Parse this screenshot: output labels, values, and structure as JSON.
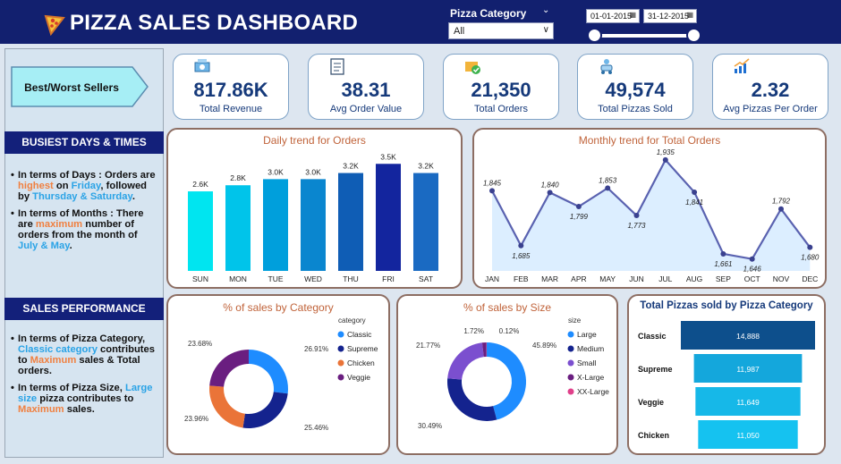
{
  "header": {
    "title": "PIZZA SALES DASHBOARD"
  },
  "filters": {
    "category_label": "Pizza Category",
    "category_value": "All",
    "date_start": "01-01-2015",
    "date_end": "31-12-2015"
  },
  "sidebar": {
    "best_worst": "Best/Worst Sellers",
    "busiest": {
      "heading": "BUSIEST DAYS & TIMES",
      "b1": {
        "t1": "In terms of Days :  Orders are ",
        "t2": "highest",
        "t3": " on ",
        "t4": "Friday",
        "t5": ", followed by ",
        "t6": "Thursday & Saturday",
        "t7": "."
      },
      "b2": {
        "t1": "In terms of Months : There are ",
        "t2": "maximum",
        "t3": " number of orders from the month of ",
        "t4": "July & May",
        "t5": "."
      }
    },
    "sales": {
      "heading": "SALES PERFORMANCE",
      "b1": {
        "t1": "In terms of Pizza Category, ",
        "t2": "Classic category",
        "t3": " contributes to ",
        "t4": "Maximum",
        "t5": " sales & Total orders."
      },
      "b2": {
        "t1": "In terms of Pizza Size, ",
        "t2": "Large size",
        "t3": " pizza contributes to ",
        "t4": "Maximum",
        "t5": " sales."
      }
    }
  },
  "kpis": [
    {
      "value": "817.86K",
      "label": "Total Revenue",
      "icon": "money-icon"
    },
    {
      "value": "38.31",
      "label": "Avg Order Value",
      "icon": "clipboard-icon"
    },
    {
      "value": "21,350",
      "label": "Total Orders",
      "icon": "cart-icon"
    },
    {
      "value": "49,574",
      "label": "Total Pizzas Sold",
      "icon": "delivery-icon"
    },
    {
      "value": "2.32",
      "label": "Avg Pizzas Per Order",
      "icon": "growth-chart-icon"
    }
  ],
  "chart_data": [
    {
      "type": "bar",
      "title": "Daily trend for Orders",
      "categories": [
        "SUN",
        "MON",
        "TUE",
        "WED",
        "THU",
        "FRI",
        "SAT"
      ],
      "values": [
        2.6,
        2.8,
        3.0,
        3.0,
        3.2,
        3.5,
        3.2
      ],
      "labels": [
        "2.6K",
        "2.8K",
        "3.0K",
        "3.0K",
        "3.2K",
        "3.5K",
        "3.2K"
      ],
      "colors": [
        "#00e5f0",
        "#00c4ea",
        "#009fdc",
        "#0a86cf",
        "#0f5db5",
        "#13259e",
        "#1a6ac2"
      ]
    },
    {
      "type": "area",
      "title": "Monthly trend for Total Orders",
      "categories": [
        "JAN",
        "FEB",
        "MAR",
        "APR",
        "MAY",
        "JUN",
        "JUL",
        "AUG",
        "SEP",
        "OCT",
        "NOV",
        "DEC"
      ],
      "values": [
        1845,
        1685,
        1840,
        1799,
        1853,
        1773,
        1935,
        1841,
        1661,
        1646,
        1792,
        1680
      ],
      "labels": [
        "1,845",
        "1,685",
        "1,840",
        "1,799",
        "1,853",
        "1,773",
        "1,935",
        "1,841",
        "1,661",
        "1,646",
        "1,792",
        "1,680"
      ]
    },
    {
      "type": "pie",
      "title": "% of sales by Category",
      "legend_title": "category",
      "slices": [
        {
          "name": "Classic",
          "value": 26.91,
          "label": "26.91%",
          "color": "#1e8cff"
        },
        {
          "name": "Supreme",
          "value": 25.46,
          "label": "25.46%",
          "color": "#14238e"
        },
        {
          "name": "Chicken",
          "value": 23.96,
          "label": "23.96%",
          "color": "#ea7438"
        },
        {
          "name": "Veggie",
          "value": 23.68,
          "label": "23.68%",
          "color": "#6a1e80"
        }
      ]
    },
    {
      "type": "pie",
      "title": "% of sales by Size",
      "legend_title": "size",
      "slices": [
        {
          "name": "Large",
          "value": 45.89,
          "label": "45.89%",
          "color": "#1e8cff"
        },
        {
          "name": "Medium",
          "value": 30.49,
          "label": "30.49%",
          "color": "#14238e"
        },
        {
          "name": "Small",
          "value": 21.77,
          "label": "21.77%",
          "color": "#7b4fcf"
        },
        {
          "name": "X-Large",
          "value": 1.72,
          "label": "1.72%",
          "color": "#6a1e80"
        },
        {
          "name": "XX-Large",
          "value": 0.12,
          "label": "0.12%",
          "color": "#e0408a"
        }
      ]
    },
    {
      "type": "bar",
      "orientation": "horizontal",
      "title": "Total Pizzas sold by Pizza Category",
      "categories": [
        "Classic",
        "Supreme",
        "Veggie",
        "Chicken"
      ],
      "values": [
        14888,
        11987,
        11649,
        11050
      ],
      "labels": [
        "14,888",
        "11,987",
        "11,649",
        "11,050"
      ],
      "colors": [
        "#0d4f8c",
        "#14a7dc",
        "#16b8e8",
        "#15c2f0"
      ]
    }
  ]
}
